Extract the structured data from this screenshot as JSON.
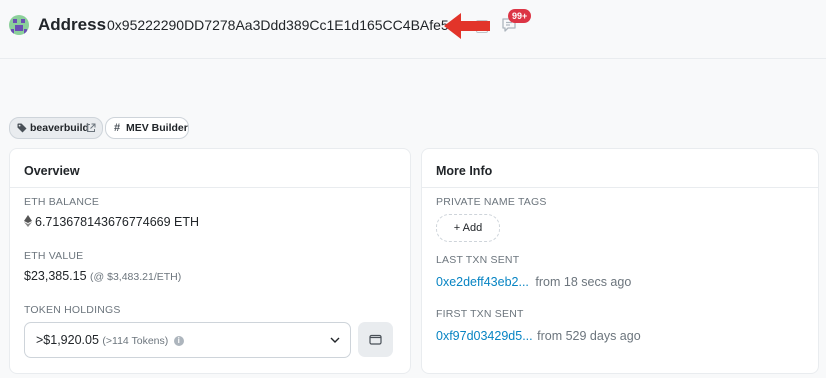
{
  "header": {
    "title": "Address",
    "address": "0x95222290DD7278Aa3Ddd389Cc1E1d165CC4BAfe5",
    "comment_badge": "99+"
  },
  "tags": [
    {
      "label": "beaverbuild"
    },
    {
      "label": "MEV Builder"
    }
  ],
  "overview": {
    "title": "Overview",
    "eth_balance_label": "ETH BALANCE",
    "eth_balance_value": "6.713678143676774669 ETH",
    "eth_value_label": "ETH VALUE",
    "eth_value_amount": "$23,385.15",
    "eth_value_rate": "(@ $3,483.21/ETH)",
    "token_holdings_label": "TOKEN HOLDINGS",
    "token_holdings_value": ">$1,920.05",
    "token_holdings_count": "(>114 Tokens)"
  },
  "more_info": {
    "title": "More Info",
    "private_tags_label": "PRIVATE NAME TAGS",
    "add_label": "Add",
    "last_txn_label": "LAST TXN SENT",
    "last_txn_hash": "0xe2deff43eb2...",
    "last_txn_time": "from 18 secs ago",
    "first_txn_label": "FIRST TXN SENT",
    "first_txn_hash": "0xf97d03429d5...",
    "first_txn_time": "from 529 days ago"
  },
  "colors": {
    "link": "#0784c3",
    "arrow": "#e2342a",
    "badge": "#dc3545"
  }
}
